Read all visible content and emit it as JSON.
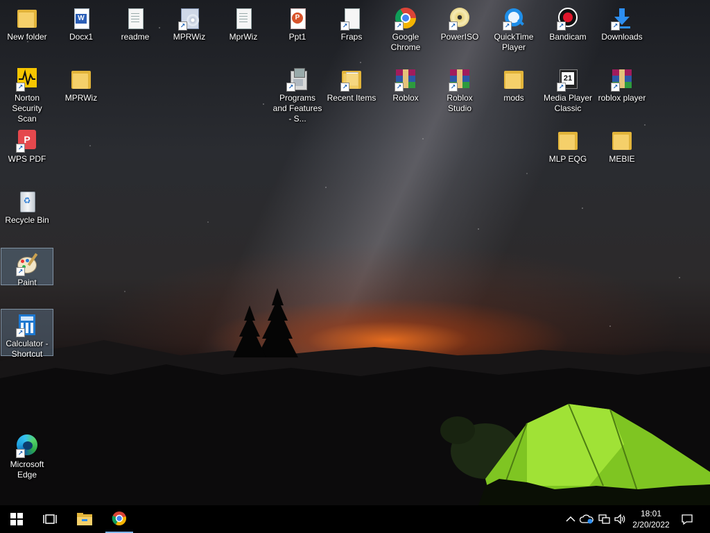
{
  "desktop": {
    "icons": {
      "new_folder": "New folder",
      "docx1": "Docx1",
      "readme": "readme",
      "mprwiz_shortcut": "MPRWiz",
      "mprwiz_file": "MprWiz",
      "ppt1": "Ppt1",
      "fraps": "Fraps",
      "google_chrome": "Google Chrome",
      "poweriso": "PowerISO",
      "quicktime": "QuickTime Player",
      "bandicam": "Bandicam",
      "downloads": "Downloads",
      "norton": "Norton Security Scan",
      "mprwiz_folder": "MPRWiz",
      "programs_features": "Programs and Features - S...",
      "recent_items": "Recent Items",
      "roblox": "Roblox",
      "roblox_studio": "Roblox Studio",
      "mods": "mods",
      "media_player_classic": "Media Player Classic",
      "roblox_player": "roblox player",
      "wps_pdf": "WPS PDF",
      "mlp_eqg": "MLP EQG",
      "mebie": "MEBIE",
      "recycle_bin": "Recycle Bin",
      "paint": "Paint",
      "calculator": "Calculator - Shortcut",
      "edge": "Microsoft Edge"
    }
  },
  "taskbar": {
    "start_icon": "windows-logo",
    "task_view_icon": "task-view",
    "pinned": [
      "file-explorer",
      "google-chrome"
    ],
    "tray": [
      "chevron-up",
      "onedrive-cloud",
      "network",
      "volume"
    ],
    "clock": {
      "time": "18:01",
      "date": "2/20/2022"
    },
    "notification_icon": "action-center"
  },
  "colors": {
    "taskbar_bg": "#000000",
    "selection_bg": "#5a6e82",
    "folder_yellow": "#f5d06a",
    "tent_green": "#8ed62a"
  }
}
